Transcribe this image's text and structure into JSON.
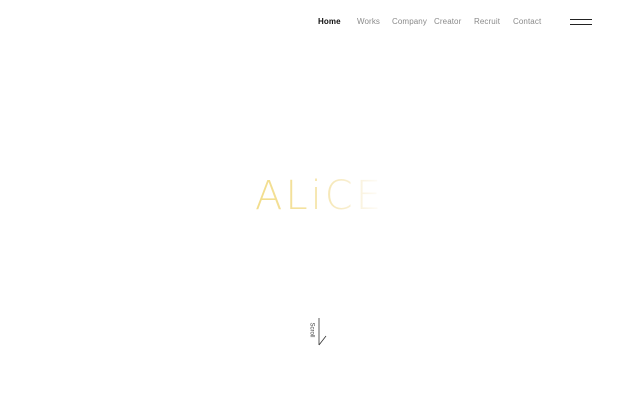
{
  "nav": {
    "items": [
      {
        "label": "Home",
        "active": true
      },
      {
        "label": "Works",
        "active": false
      },
      {
        "label": "Company",
        "active": false
      },
      {
        "label": "Creator",
        "active": false
      },
      {
        "label": "Recruit",
        "active": false
      },
      {
        "label": "Contact",
        "active": false
      }
    ],
    "menu_icon": "hamburger-icon"
  },
  "hero": {
    "logo_text": "ALiCE",
    "logo_gradient": [
      "#f2dd8c",
      "#ffffff"
    ]
  },
  "scroll": {
    "label": "Scroll",
    "icon": "arrow-down-icon"
  },
  "colors": {
    "background": "#ffffff",
    "nav_active": "#111111",
    "nav_inactive": "#8a8a8a",
    "accent_gold": "#f2dd8c"
  }
}
